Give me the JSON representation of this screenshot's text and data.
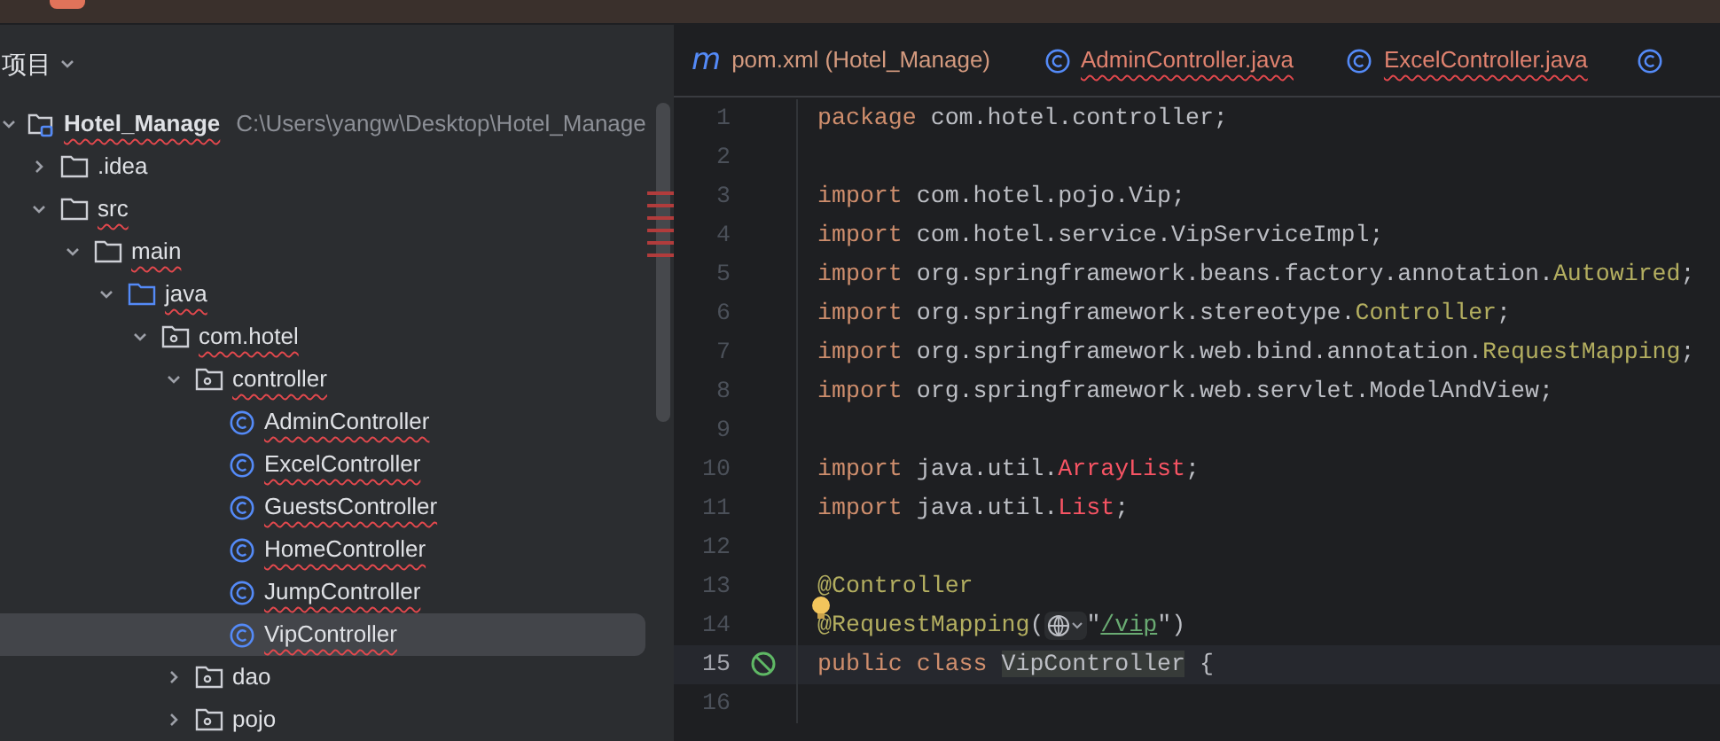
{
  "project_panel": {
    "title": "项目",
    "tree": [
      {
        "name": "Hotel_Manage",
        "kind": "module",
        "path": "C:\\Users\\yangw\\Desktop\\Hotel_Manage",
        "expanded": true,
        "error": true,
        "selected": false,
        "children": [
          {
            "name": ".idea",
            "kind": "folder",
            "expanded": false,
            "error": false,
            "selected": false
          },
          {
            "name": "src",
            "kind": "folder",
            "expanded": true,
            "error": true,
            "selected": false,
            "children": [
              {
                "name": "main",
                "kind": "folder",
                "expanded": true,
                "error": true,
                "selected": false,
                "children": [
                  {
                    "name": "java",
                    "kind": "source_folder",
                    "expanded": true,
                    "error": true,
                    "selected": false,
                    "children": [
                      {
                        "name": "com.hotel",
                        "kind": "package",
                        "expanded": true,
                        "error": true,
                        "selected": false,
                        "children": [
                          {
                            "name": "controller",
                            "kind": "package",
                            "expanded": true,
                            "error": true,
                            "selected": false,
                            "children": [
                              {
                                "name": "AdminController",
                                "kind": "class",
                                "error": true,
                                "selected": false
                              },
                              {
                                "name": "ExcelController",
                                "kind": "class",
                                "error": true,
                                "selected": false
                              },
                              {
                                "name": "GuestsController",
                                "kind": "class",
                                "error": true,
                                "selected": false
                              },
                              {
                                "name": "HomeController",
                                "kind": "class",
                                "error": true,
                                "selected": false
                              },
                              {
                                "name": "JumpController",
                                "kind": "class",
                                "error": true,
                                "selected": false
                              },
                              {
                                "name": "VipController",
                                "kind": "class",
                                "error": true,
                                "selected": true
                              }
                            ]
                          },
                          {
                            "name": "dao",
                            "kind": "package",
                            "expanded": false,
                            "error": false,
                            "selected": false
                          },
                          {
                            "name": "pojo",
                            "kind": "package",
                            "expanded": false,
                            "error": false,
                            "selected": false
                          }
                        ]
                      }
                    ]
                  }
                ]
              }
            ]
          }
        ]
      }
    ]
  },
  "editor": {
    "tabs": [
      {
        "label": "pom.xml (Hotel_Manage)",
        "kind": "maven",
        "icon_text": "m",
        "error": false
      },
      {
        "label": "AdminController.java",
        "kind": "class",
        "error": true
      },
      {
        "label": "ExcelController.java",
        "kind": "class",
        "error": true
      },
      {
        "kind": "class"
      }
    ],
    "lines": [
      {
        "number": "1",
        "current": false,
        "tokens": [
          {
            "kind": "keyword",
            "text": "package "
          },
          {
            "kind": "plain",
            "text": "com.hotel.controller;"
          }
        ]
      },
      {
        "number": "2",
        "current": false
      },
      {
        "number": "3",
        "current": false,
        "tokens": [
          {
            "kind": "keyword",
            "text": "import "
          },
          {
            "kind": "plain",
            "text": "com.hotel.pojo.Vip;"
          }
        ]
      },
      {
        "number": "4",
        "current": false,
        "tokens": [
          {
            "kind": "keyword",
            "text": "import "
          },
          {
            "kind": "plain",
            "text": "com.hotel.service.VipServiceImpl;"
          }
        ]
      },
      {
        "number": "5",
        "current": false,
        "tokens": [
          {
            "kind": "keyword",
            "text": "import "
          },
          {
            "kind": "plain",
            "text": "org.springframework.beans.factory.annotation."
          },
          {
            "kind": "annotation",
            "text": "Autowired"
          },
          {
            "kind": "plain",
            "text": ";"
          }
        ]
      },
      {
        "number": "6",
        "current": false,
        "tokens": [
          {
            "kind": "keyword",
            "text": "import "
          },
          {
            "kind": "plain",
            "text": "org.springframework.stereotype."
          },
          {
            "kind": "annotation",
            "text": "Controller"
          },
          {
            "kind": "plain",
            "text": ";"
          }
        ]
      },
      {
        "number": "7",
        "current": false,
        "tokens": [
          {
            "kind": "keyword",
            "text": "import "
          },
          {
            "kind": "plain",
            "text": "org.springframework.web.bind.annotation."
          },
          {
            "kind": "annotation",
            "text": "RequestMapping"
          },
          {
            "kind": "plain",
            "text": ";"
          }
        ]
      },
      {
        "number": "8",
        "current": false,
        "tokens": [
          {
            "kind": "keyword",
            "text": "import "
          },
          {
            "kind": "plain",
            "text": "org.springframework.web.servlet.ModelAndView;"
          }
        ]
      },
      {
        "number": "9",
        "current": false
      },
      {
        "number": "10",
        "current": false,
        "tokens": [
          {
            "kind": "keyword",
            "text": "import "
          },
          {
            "kind": "plain",
            "text": "java.util."
          },
          {
            "kind": "unresolved",
            "text": "ArrayList"
          },
          {
            "kind": "plain",
            "text": ";"
          }
        ]
      },
      {
        "number": "11",
        "current": false,
        "tokens": [
          {
            "kind": "keyword",
            "text": "import "
          },
          {
            "kind": "plain",
            "text": "java.util."
          },
          {
            "kind": "unresolved",
            "text": "List"
          },
          {
            "kind": "plain",
            "text": ";"
          }
        ]
      },
      {
        "number": "12",
        "current": false
      },
      {
        "number": "13",
        "current": false,
        "tokens": [
          {
            "kind": "annotation",
            "text": "@Controller"
          }
        ]
      },
      {
        "number": "14",
        "current": false,
        "bulb": true,
        "tokens": [
          {
            "kind": "annotation",
            "text": "@RequestMapping"
          },
          {
            "kind": "plain",
            "text": "("
          },
          {
            "kind": "url_hint"
          },
          {
            "kind": "plain",
            "text": "\""
          },
          {
            "kind": "string",
            "text": "/vip"
          },
          {
            "kind": "plain",
            "text": "\")"
          }
        ]
      },
      {
        "number": "15",
        "current": true,
        "gutter_icon": true,
        "tokens": [
          {
            "kind": "keyword",
            "text": "public class "
          },
          {
            "kind": "highlighted",
            "text": "VipController"
          },
          {
            "kind": "plain",
            "text": " {"
          }
        ]
      },
      {
        "number": "16",
        "current": false
      }
    ]
  }
}
